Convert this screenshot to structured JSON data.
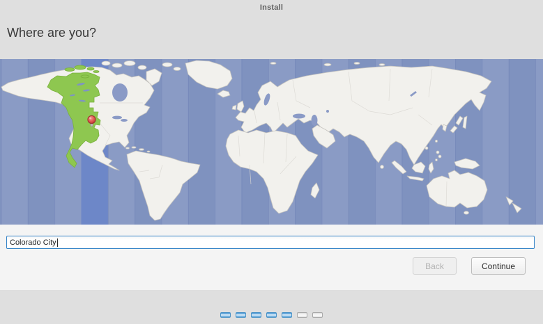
{
  "window": {
    "title": "Install"
  },
  "heading": "Where are you?",
  "location_input": {
    "value": "Colorado City",
    "placeholder": ""
  },
  "buttons": {
    "back": "Back",
    "continue": "Continue"
  },
  "progress": {
    "total": 7,
    "completed": 5
  },
  "map": {
    "selected_city": "Colorado City",
    "marker": "red-location-pin",
    "highlighted_region": "mountain-timezone-green",
    "selected_band_x": [
      116.5,
      154.8
    ]
  },
  "colors": {
    "window_bg": "#dfdfdf",
    "panel_bg": "#f4f4f4",
    "input_focus_border": "#3584c8",
    "ocean": "#8496c2",
    "selected_timezone_band": "#6d87c8",
    "timezone_highlight_green": "#8ec750",
    "land": "#f2f1ed",
    "pin_red": "#d9534f",
    "progress_blue": "#5ca2d8"
  }
}
